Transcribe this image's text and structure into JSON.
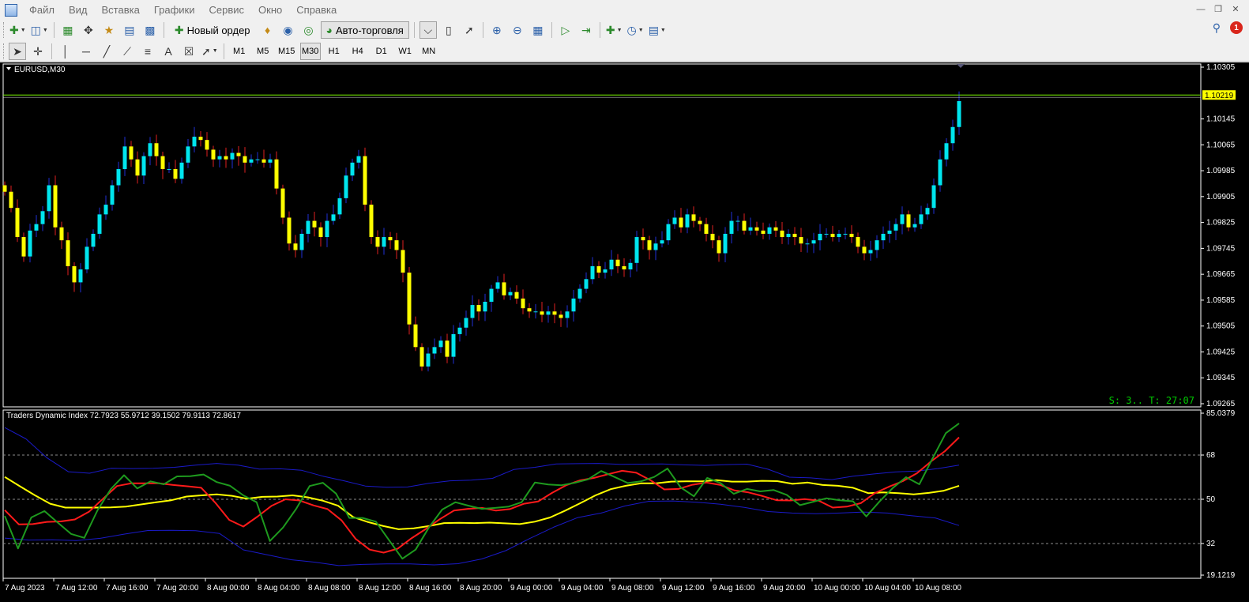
{
  "menu": {
    "items": [
      "Файл",
      "Вид",
      "Вставка",
      "Графики",
      "Сервис",
      "Окно",
      "Справка"
    ]
  },
  "toolbar": {
    "new_order_label": "Новый ордер",
    "autotrading_label": "Авто-торговля",
    "timeframes": [
      "M1",
      "M5",
      "M15",
      "M30",
      "H1",
      "H4",
      "D1",
      "W1",
      "MN"
    ],
    "active_timeframe": "M30",
    "text_tool_label": "A",
    "notification_count": "1"
  },
  "chart": {
    "symbol_label": "EURUSD,M30",
    "current_price_label": "1.10219",
    "status_text": "S: 3.. T: 27:07",
    "price_axis_labels": [
      "1.10305",
      "1.10145",
      "1.10065",
      "1.09985",
      "1.09905",
      "1.09825",
      "1.09745",
      "1.09665",
      "1.09585",
      "1.09505",
      "1.09425",
      "1.09345",
      "1.09265"
    ],
    "indicator_label": "Traders Dynamic Index 72.7923 55.9712 39.1502 79.9113 72.8617",
    "indicator_axis_labels": [
      "85.0379",
      "68",
      "50",
      "32",
      "19.1219"
    ],
    "time_axis_labels": [
      "7 Aug 2023",
      "7 Aug 12:00",
      "7 Aug 16:00",
      "7 Aug 20:00",
      "8 Aug 00:00",
      "8 Aug 04:00",
      "8 Aug 08:00",
      "8 Aug 12:00",
      "8 Aug 16:00",
      "8 Aug 20:00",
      "9 Aug 00:00",
      "9 Aug 04:00",
      "9 Aug 08:00",
      "9 Aug 12:00",
      "9 Aug 16:00",
      "9 Aug 20:00",
      "10 Aug 00:00",
      "10 Aug 04:00",
      "10 Aug 08:00"
    ],
    "colors": {
      "bull": "#00e5ee",
      "bear": "#ffff00",
      "wick_bull": "#1f2fd6",
      "wick_bear": "#e02020",
      "price_line": "#7cfc00",
      "status": "#00c800",
      "tdi_rsi": "#1e9a1e",
      "tdi_signal": "#ff1a1a",
      "tdi_market_base": "#ffff00",
      "tdi_bands": "#1a1ac8"
    }
  },
  "chart_data": {
    "type": "candlestick",
    "price_range": [
      1.09265,
      1.10305
    ],
    "closes": [
      1.0992,
      1.0987,
      1.0978,
      1.0972,
      1.098,
      1.0982,
      1.0986,
      1.0994,
      1.0981,
      1.0977,
      1.0969,
      1.0964,
      1.0968,
      1.0975,
      1.0979,
      1.0985,
      1.0988,
      1.0994,
      1.0999,
      1.1006,
      1.1002,
      1.0997,
      1.1003,
      1.1007,
      1.1003,
      1.0999,
      1.0999,
      1.0996,
      1.1001,
      1.1006,
      1.1009,
      1.1008,
      1.1005,
      1.1002,
      1.1003,
      1.1002,
      1.1004,
      1.1003,
      1.1001,
      1.1002,
      1.1002,
      1.1001,
      1.1002,
      1.0993,
      1.0984,
      1.0976,
      1.0974,
      1.0979,
      1.0983,
      1.0981,
      1.0978,
      1.0983,
      1.0985,
      1.099,
      1.0997,
      1.1001,
      1.1003,
      1.0988,
      1.0978,
      1.0975,
      1.0978,
      1.0977,
      1.0974,
      1.0967,
      1.0951,
      1.0944,
      1.0938,
      1.0942,
      1.0944,
      1.0946,
      1.0941,
      1.0948,
      1.095,
      1.0953,
      1.0957,
      1.0955,
      1.0958,
      1.0962,
      1.0964,
      1.096,
      1.0961,
      1.0959,
      1.0956,
      1.0955,
      1.0955,
      1.0954,
      1.0955,
      1.0954,
      1.0953,
      1.0955,
      1.0959,
      1.0962,
      1.0965,
      1.0969,
      1.0967,
      1.0968,
      1.0971,
      1.0969,
      1.0968,
      1.097,
      1.0978,
      1.0977,
      1.0974,
      1.0976,
      1.0977,
      1.0982,
      1.0984,
      1.0981,
      1.0985,
      1.0983,
      1.0982,
      1.0979,
      1.0977,
      1.0973,
      1.0979,
      1.0983,
      1.0983,
      1.098,
      1.0981,
      1.098,
      1.0979,
      1.0981,
      1.098,
      1.0978,
      1.0979,
      1.0978,
      1.0976,
      1.0976,
      1.0977,
      1.0979,
      1.0979,
      1.0978,
      1.0979,
      1.0979,
      1.0978,
      1.0975,
      1.0973,
      1.0974,
      1.0977,
      1.0979,
      1.098,
      1.0982,
      1.0985,
      1.0981,
      1.0982,
      1.0985,
      1.0987,
      1.0994,
      1.1002,
      1.1007,
      1.1012,
      1.102
    ]
  },
  "indicator_data": {
    "type": "line",
    "name": "Traders Dynamic Index",
    "range": [
      19.1219,
      85.0379
    ],
    "rsi": [
      43.2,
      30.0,
      42.6,
      45.2,
      40.5,
      35.9,
      34.3,
      45.5,
      54.1,
      59.8,
      54.4,
      57.3,
      56.1,
      59.3,
      59.4,
      60.1,
      57.0,
      55.5,
      51.6,
      48.8,
      33.0,
      38.5,
      46.2,
      55.4,
      56.7,
      52.3,
      42.4,
      42.4,
      40.9,
      33.3,
      25.8,
      29.5,
      38.5,
      45.8,
      48.8,
      47.4,
      46.1,
      46.5,
      47.0,
      48.8,
      56.8,
      56.0,
      55.7,
      56.7,
      58.1,
      61.5,
      59.1,
      56.6,
      57.3,
      59.1,
      62.5,
      54.8,
      51.2,
      58.7,
      56.6,
      52.2,
      54.2,
      53.2,
      53.8,
      51.8,
      47.6,
      49.0,
      50.4,
      49.6,
      49.2,
      43.0,
      49.1,
      54.6,
      59.0,
      56.1,
      66.6,
      76.9,
      80.9
    ],
    "signal": [
      45.6,
      39.8,
      39.9,
      40.8,
      41.0,
      41.8,
      44.9,
      50.2,
      55.4,
      56.5,
      56.5,
      56.5,
      55.8,
      55.3,
      54.7,
      48.6,
      41.6,
      38.9,
      42.9,
      47.3,
      50.0,
      49.5,
      47.5,
      46.0,
      41.4,
      33.9,
      29.5,
      28.3,
      29.9,
      34.2,
      37.9,
      41.9,
      45.4,
      46.1,
      46.5,
      45.4,
      46.0,
      48.2,
      49.1,
      52.6,
      55.7,
      57.7,
      58.7,
      60.2,
      61.6,
      60.8,
      57.8,
      54.0,
      54.2,
      55.9,
      56.8,
      55.8,
      53.6,
      52.8,
      51.3,
      49.6,
      49.5,
      50.1,
      49.4,
      46.6,
      47.0,
      48.4,
      52.5,
      55.1,
      57.4,
      60.6,
      65.4,
      69.6,
      75.2
    ],
    "base": [
      59.1,
      55.3,
      51.6,
      48.2,
      46.6,
      46.6,
      46.6,
      46.7,
      47.0,
      47.9,
      48.8,
      49.6,
      51.1,
      51.6,
      52.0,
      51.4,
      50.2,
      51.0,
      51.1,
      51.6,
      50.8,
      49.4,
      47.4,
      42.8,
      40.7,
      39.1,
      37.8,
      38.2,
      39.1,
      40.3,
      40.4,
      40.3,
      40.5,
      40.2,
      39.9,
      40.9,
      42.6,
      45.4,
      48.4,
      51.6,
      54.1,
      55.5,
      56.5,
      56.5,
      57.2,
      57.3,
      57.3,
      57.8,
      57.2,
      57.2,
      57.5,
      57.4,
      56.3,
      56.8,
      55.8,
      55.5,
      54.7,
      52.5,
      52.8,
      52.5,
      52.0,
      52.6,
      53.5,
      55.5
    ],
    "upper_band": [
      79.2,
      74.6,
      66.8,
      61.2,
      60.6,
      62.6,
      62.5,
      62.6,
      63.0,
      63.9,
      64.6,
      63.9,
      62.3,
      62.4,
      61.8,
      59.4,
      57.5,
      55.4,
      54.9,
      55.0,
      56.5,
      57.5,
      57.8,
      58.5,
      62.1,
      63.0,
      64.4,
      64.5,
      64.6,
      64.2,
      64.3,
      64.4,
      64.0,
      63.8,
      64.1,
      64.3,
      62.2,
      59.0,
      58.7,
      58.0,
      59.4,
      60.3,
      61.1,
      61.5,
      62.5,
      63.9
    ],
    "lower_band": [
      34.2,
      33.4,
      33.5,
      33.2,
      34.1,
      35.8,
      37.3,
      37.4,
      37.2,
      36.1,
      29.4,
      27.4,
      25.4,
      24.4,
      23.0,
      23.5,
      23.7,
      23.7,
      23.3,
      23.8,
      25.7,
      29.1,
      34.0,
      38.6,
      42.5,
      44.4,
      47.3,
      49.2,
      49.3,
      48.8,
      48.0,
      46.7,
      45.0,
      44.4,
      44.1,
      44.4,
      44.8,
      44.4,
      43.3,
      42.4,
      39.3
    ],
    "levels": [
      68,
      50,
      32
    ]
  }
}
